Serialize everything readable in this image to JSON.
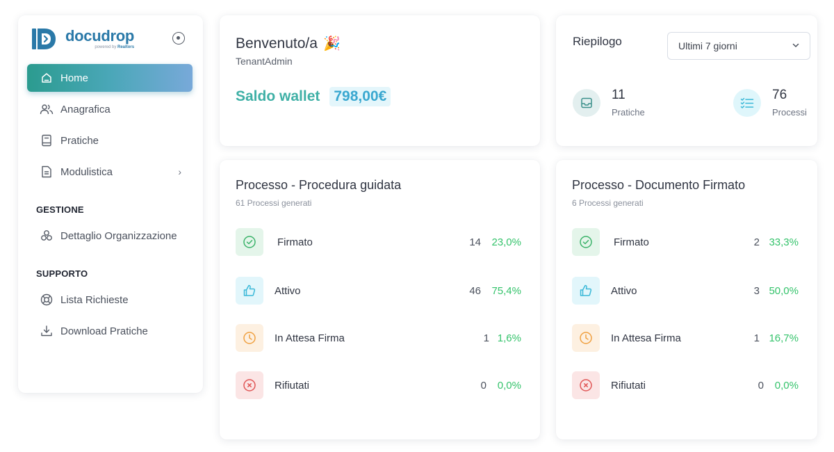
{
  "brand": {
    "name": "docudrop",
    "powered_prefix": "powered by",
    "powered_name": "Realtors"
  },
  "nav": {
    "items": [
      {
        "label": "Home",
        "icon": "home-icon",
        "active": true
      },
      {
        "label": "Anagrafica",
        "icon": "users-icon"
      },
      {
        "label": "Pratiche",
        "icon": "book-icon"
      },
      {
        "label": "Modulistica",
        "icon": "document-icon",
        "has_submenu": true
      }
    ],
    "section_gestione": "GESTIONE",
    "gestione_items": [
      {
        "label": "Dettaglio Organizzazione",
        "icon": "organization-icon"
      }
    ],
    "section_supporto": "SUPPORTO",
    "supporto_items": [
      {
        "label": "Lista Richieste",
        "icon": "lifebuoy-icon"
      },
      {
        "label": "Download Pratiche",
        "icon": "download-icon"
      }
    ]
  },
  "welcome": {
    "title": "Benvenuto/a",
    "emoji": "🎉",
    "subtitle": "TenantAdmin",
    "wallet_label": "Saldo wallet",
    "wallet_value": "798,00€"
  },
  "summary": {
    "title": "Riepilogo",
    "period_selected": "Ultimi 7 giorni",
    "stats": [
      {
        "value": "11",
        "label": "Pratiche",
        "icon": "inbox-icon",
        "color": "#e3efef"
      },
      {
        "value": "76",
        "label": "Processi",
        "icon": "checklist-icon",
        "color": "#dff6fb"
      }
    ]
  },
  "processes": [
    {
      "title": "Processo - Procedura guidata",
      "subtitle": "61 Processi generati",
      "rows": [
        {
          "label": "Firmato",
          "count": "14",
          "percent": "23,0%",
          "icon": "check-circle-icon"
        },
        {
          "label": "Attivo",
          "count": "46",
          "percent": "75,4%",
          "icon": "thumbs-up-icon"
        },
        {
          "label": "In Attesa Firma",
          "count": "1",
          "percent": "1,6%",
          "icon": "clock-icon"
        },
        {
          "label": "Rifiutati",
          "count": "0",
          "percent": "0,0%",
          "icon": "x-circle-icon"
        }
      ]
    },
    {
      "title": "Processo - Documento Firmato",
      "subtitle": "6 Processi generati",
      "rows": [
        {
          "label": "Firmato",
          "count": "2",
          "percent": "33,3%",
          "icon": "check-circle-icon"
        },
        {
          "label": "Attivo",
          "count": "3",
          "percent": "50,0%",
          "icon": "thumbs-up-icon"
        },
        {
          "label": "In Attesa Firma",
          "count": "1",
          "percent": "16,7%",
          "icon": "clock-icon"
        },
        {
          "label": "Rifiutati",
          "count": "0",
          "percent": "0,0%",
          "icon": "x-circle-icon"
        }
      ]
    }
  ],
  "colors": {
    "accent": "#2a79a8",
    "wallet_label": "#3fb0a6",
    "wallet_value": "#3aa8d0",
    "percent_green": "#34c36b",
    "status_firmato_bg": "#e4f5ea",
    "status_attivo_bg": "#e2f6fb",
    "status_attesa_bg": "#fdf0e1",
    "status_rifiutati_bg": "#fbe5e5"
  }
}
